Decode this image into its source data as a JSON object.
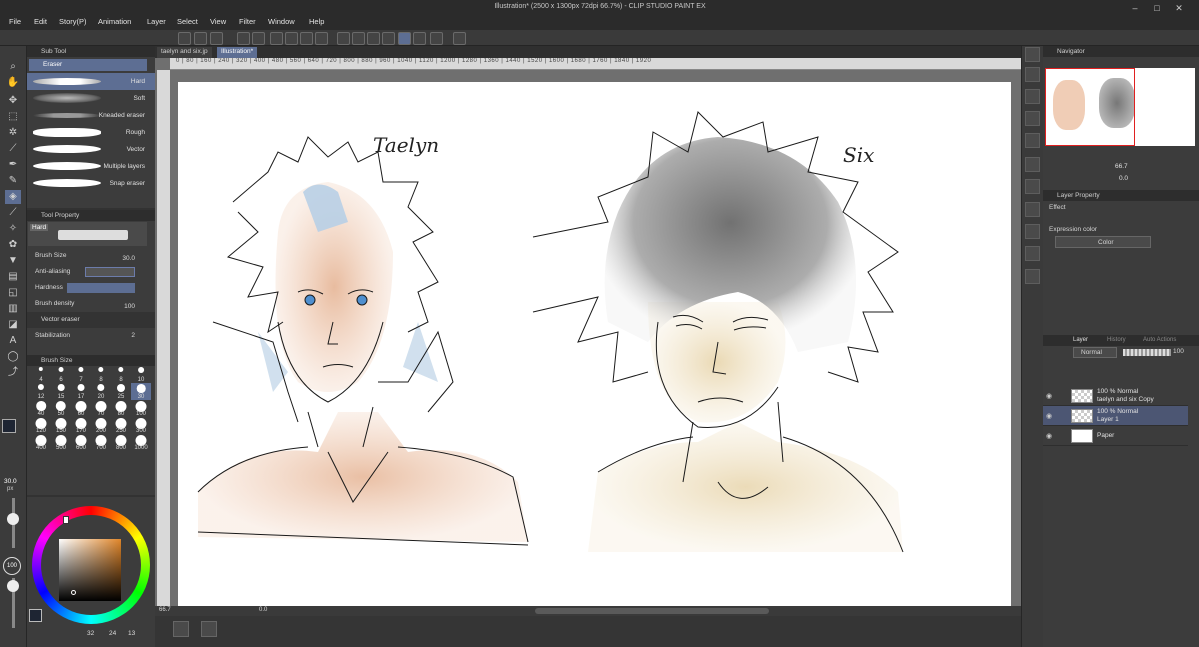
{
  "window": {
    "title": "Illustration* (2500 x 1300px 72dpi 66.7%) - CLIP STUDIO PAINT EX",
    "controls": [
      "–",
      "□",
      "✕"
    ]
  },
  "menu": [
    "File",
    "Edit",
    "Story(P)",
    "Animation",
    "Layer",
    "Select",
    "View",
    "Filter",
    "Window",
    "Help"
  ],
  "tabs": [
    "taelyn and six.jp",
    "Illustration*"
  ],
  "ruler": "0 | 80 | 160 | 240 | 320 | 400 | 480 | 560 | 640 | 720 | 800 | 880 | 960 | 1040 | 1120 | 1200 | 1280 | 1360 | 1440 | 1520 | 1600 | 1680 | 1760 | 1840 | 1920",
  "subtool": {
    "header": "Sub Tool",
    "group": "Eraser",
    "items": [
      "Hard",
      "Soft",
      "Kneaded eraser",
      "Rough",
      "Vector",
      "Multiple layers",
      "Snap eraser"
    ],
    "selected_index": 0
  },
  "tool_property": {
    "header": "Tool Property",
    "preset": "Hard",
    "brush_size_label": "Brush Size",
    "brush_size_value": "30.0",
    "anti_aliasing_label": "Anti-aliasing",
    "hardness_label": "Hardness",
    "brush_density_label": "Brush density",
    "brush_density_value": "100",
    "vector_eraser_label": "Vector eraser",
    "stabilization_label": "Stabilization",
    "stabilization_value": "2"
  },
  "brush_size": {
    "header": "Brush Size",
    "sizes": [
      "4",
      "6",
      "7",
      "8",
      "8",
      "10",
      "12",
      "15",
      "17",
      "20",
      "25",
      "30",
      "40",
      "50",
      "60",
      "70",
      "80",
      "100",
      "120",
      "150",
      "170",
      "200",
      "250",
      "300",
      "400",
      "500",
      "600",
      "700",
      "800",
      "1000"
    ],
    "selected": "30"
  },
  "left_status": {
    "size_value": "30.0",
    "size_unit": "px",
    "opacity_value": "100"
  },
  "color": {
    "main": "#1e2533",
    "sub": "#ffffff",
    "picker_base": "#e0862a",
    "swatch_counts": [
      "32",
      "24",
      "13"
    ]
  },
  "canvas": {
    "label_left": "Taelyn",
    "label_right": "Six"
  },
  "bottom": {
    "zoom": "66.7",
    "angle": "0.0"
  },
  "navigator": {
    "header": "Navigator",
    "zoom": "66.7",
    "angle": "0.0"
  },
  "layer_property": {
    "header": "Layer Property",
    "effect_label": "Effect",
    "expression_label": "Expression color",
    "expression_value": "Color"
  },
  "layer_panel": {
    "tabs": [
      "Layer",
      "History",
      "Auto Actions"
    ],
    "blend_mode": "Normal",
    "opacity": "100",
    "layers": [
      {
        "line1": "100 % Normal",
        "line2": "taelyn and six Copy",
        "selected": false
      },
      {
        "line1": "100 % Normal",
        "line2": "Layer 1",
        "selected": true
      },
      {
        "line1": "",
        "line2": "Paper",
        "selected": false
      }
    ]
  }
}
